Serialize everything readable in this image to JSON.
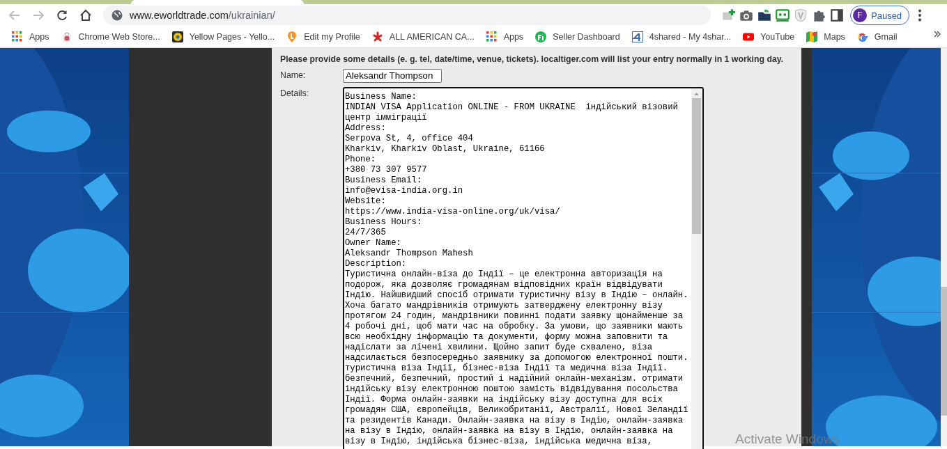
{
  "browser": {
    "url_host": "www.eworldtrade.com",
    "url_path": "/ukrainian/",
    "profile": {
      "initial": "F",
      "status": "Paused"
    }
  },
  "bookmarks": [
    {
      "label": "Apps",
      "kind": "apps"
    },
    {
      "label": "Chrome Web Store...",
      "kind": "store"
    },
    {
      "label": "Yellow Pages - Yello...",
      "kind": "gear"
    },
    {
      "label": "Edit my Profile",
      "kind": "pin"
    },
    {
      "label": "ALL AMERICAN CA...",
      "kind": "burst"
    },
    {
      "label": "Apps",
      "kind": "apps"
    },
    {
      "label": "Seller Dashboard",
      "kind": "leaf"
    },
    {
      "label": "4shared - My 4shar...",
      "kind": "four"
    },
    {
      "label": "YouTube",
      "kind": "play"
    },
    {
      "label": "Maps",
      "kind": "map"
    },
    {
      "label": "Gmail",
      "kind": "g"
    }
  ],
  "form": {
    "instructions": "Please provide some details (e. g. tel, date/time, venue, tickets). localtiger.com will list your entry normally in 1 working day.",
    "fields": [
      {
        "label": "Name:",
        "kind": "input",
        "value": "Aleksandr Thompson"
      },
      {
        "label": "Details:",
        "kind": "textarea",
        "value": "Business Name:\nINDIAN VISA Application ONLINE - FROM UKRAINE  індійський візовий центр імміграції\nAddress:\nSerpova St, 4, office 404\nKharkiv, Kharkiv Oblast, Ukraine, 61166\nPhone:\n+380 73 307 9577\nBusiness Email:\ninfo@evisa-india.org.in\nWebsite:\nhttps://www.india-visa-online.org/uk/visa/\nBusiness Hours:\n24/7/365\nOwner Name:\nAleksandr Thompson Mahesh\nDescription:\nТуристична онлайн-віза до Індії – це електронна авторизація на подорож, яка дозволяє громадянам відповідних країн відвідувати Індію. Найшвидший спосіб отримати туристичну візу в Індію – онлайн. Хоча багато мандрівників отримують затверджену електронну візу протягом 24 годин, мандрівники повинні подати заявку щонайменше за 4 робочі дні, щоб мати час на обробку. За умови, що заявники мають всю необхідну інформацію та документи, форму можна заповнити та надіслати за лічені хвилини. Щойно запит буде схвалено, віза надсилається безпосередньо заявнику за допомогою електронної пошти. туристична віза Індії, бізнес-віза Індії та медична віза Індії. безпечний, безпечний, простий і надійний онлайн-механізм. отримати індійську візу електронною поштою замість відвідування посольства Індії. Форма онлайн-заявки на індійську візу доступна для всіх громадян США, європейців, Великобританії, Австралії, Нової Зеландії та резидентів Канади. Онлайн-заявка на візу в Індію, онлайн-заявка на візу в Індію, онлайн-заявка на візу в Індію, онлайн-заявка на візу в Індію, індійська бізнес-віза, індійська медична віза,"
      }
    ]
  },
  "os_notice": "Activate Windows"
}
